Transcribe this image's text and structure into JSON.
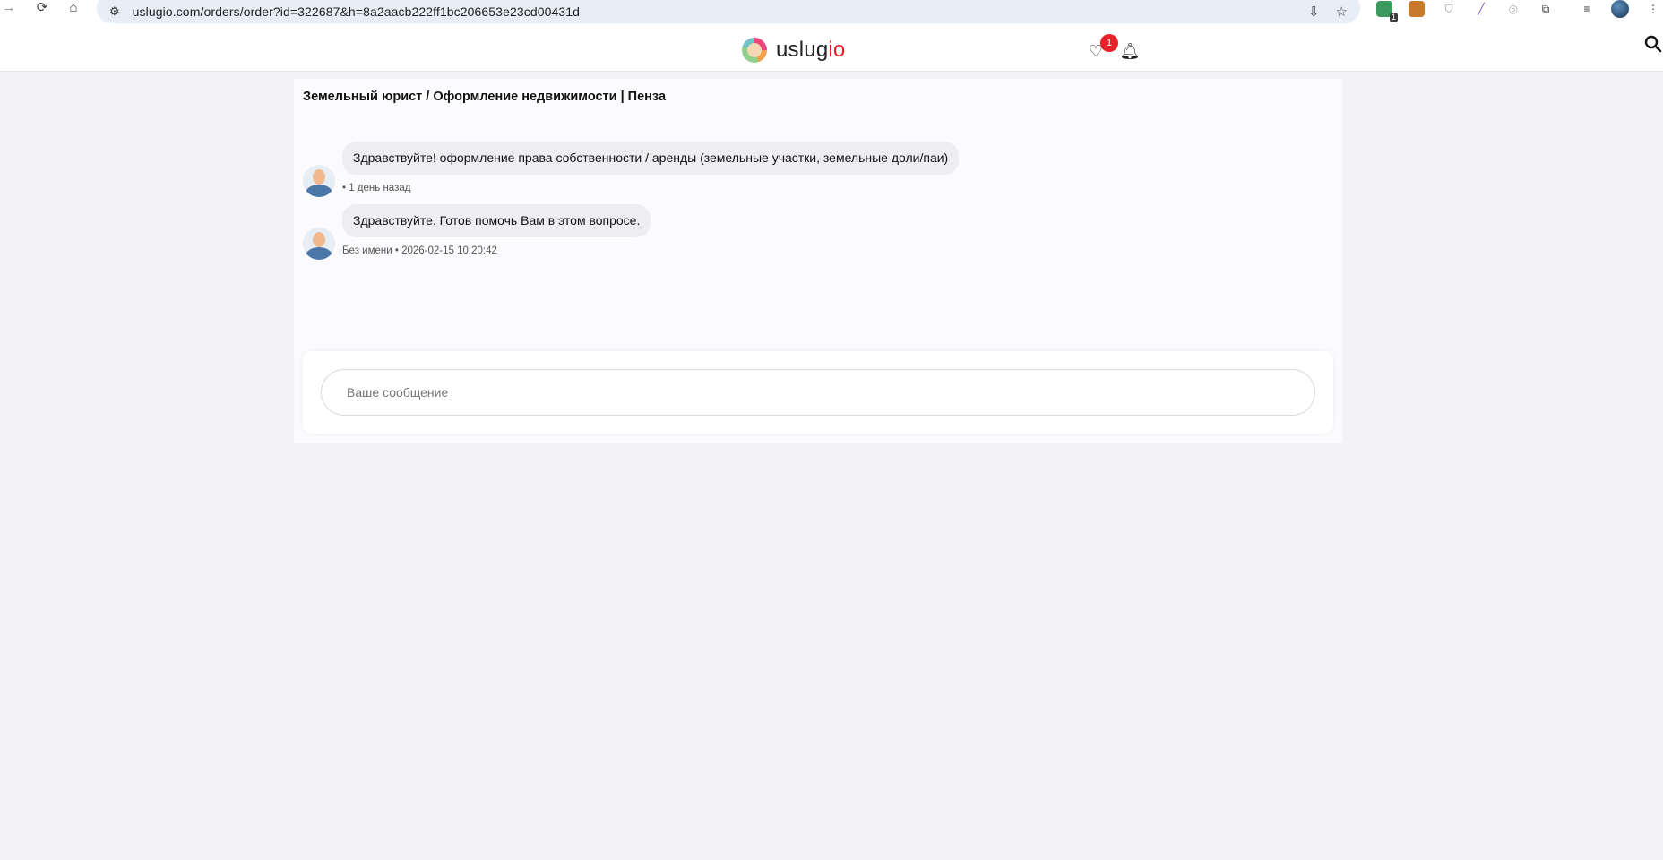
{
  "browser": {
    "url": "uslugio.com/orders/order?id=322687&h=8a2aacb222ff1bc206653e23cd00431d",
    "extension_badge": "1",
    "icons": [
      "back-arrow-icon",
      "reload-icon",
      "home-icon",
      "site-settings-icon",
      "install-app-icon",
      "bookmark-star-icon",
      "extensions-puzzle-icon",
      "media-controls-icon",
      "profile-avatar-icon",
      "chrome-menu-icon"
    ]
  },
  "header": {
    "logo_main": "uslug",
    "logo_accent": "io",
    "favorites_count": "1",
    "icons": [
      "heart-icon",
      "bell-icon",
      "search-icon"
    ]
  },
  "chat": {
    "title": "Земельный юрист / Оформление недвижимости | Пенза",
    "messages": [
      {
        "text": "Здравствуйте! оформление права собственности / аренды (земельные участки, земельные доли/паи)",
        "meta": "• 1 день назад"
      },
      {
        "text": "Здравствуйте. Готов помочь Вам в этом вопросе.",
        "meta": "Без имени • 2026-02-15 10:20:42"
      }
    ],
    "input_placeholder": "Ваше сообщение"
  },
  "colors": {
    "accent": "#e8202a",
    "page_bg": "#f4f4f8",
    "bubble_bg": "#eeeef2",
    "avatar_body": "#4a77a8"
  }
}
